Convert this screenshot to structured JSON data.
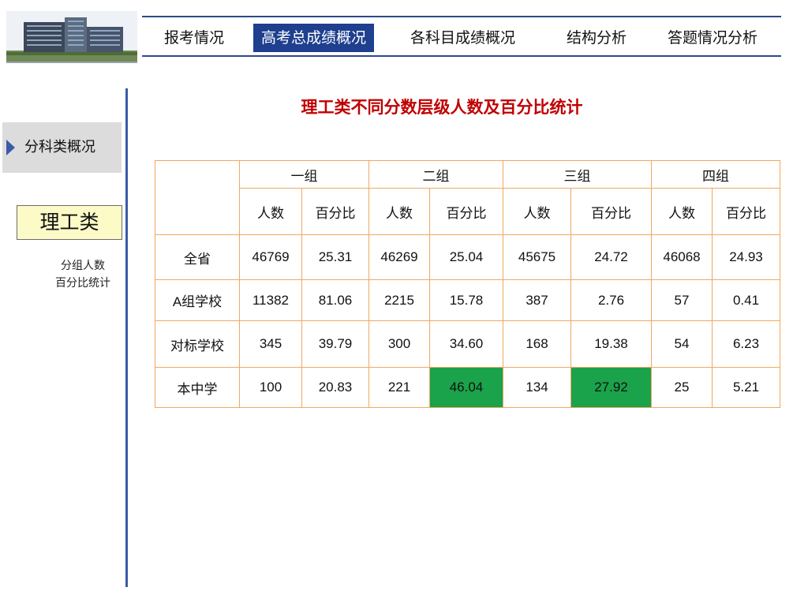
{
  "nav": {
    "items": [
      "报考情况",
      "高考总成绩概况",
      "各科目成绩概况",
      "结构分析",
      "答题情况分析"
    ],
    "active_index": 1
  },
  "sidebar": {
    "tab_label": "分科类概况",
    "category_label": "理工类",
    "note_lines": [
      "分组人数",
      "百分比统计"
    ]
  },
  "main": {
    "title": "理工类不同分数层级人数及百分比统计",
    "table": {
      "groups": [
        "一组",
        "二组",
        "三组",
        "四组"
      ],
      "subheaders": [
        "人数",
        "百分比",
        "人数",
        "百分比",
        "人数",
        "百分比",
        "人数",
        "百分比"
      ],
      "rows": [
        {
          "label": "全省",
          "cells": [
            "46769",
            "25.31",
            "46269",
            "25.04",
            "45675",
            "24.72",
            "46068",
            "24.93"
          ]
        },
        {
          "label": "A组学校",
          "cells": [
            "11382",
            "81.06",
            "2215",
            "15.78",
            "387",
            "2.76",
            "57",
            "0.41"
          ]
        },
        {
          "label": "对标学校",
          "cells": [
            "345",
            "39.79",
            "300",
            "34.60",
            "168",
            "19.38",
            "54",
            "6.23"
          ]
        },
        {
          "label": "本中学",
          "cells": [
            "100",
            "20.83",
            "221",
            "46.04",
            "134",
            "27.92",
            "25",
            "5.21"
          ]
        }
      ],
      "highlighted_cells": [
        [
          3,
          3
        ],
        [
          3,
          5
        ]
      ],
      "highlight_color": "#1aa34a",
      "border_color": "#f0a860"
    }
  },
  "colors": {
    "title": "#c00000",
    "nav_active_bg": "#1f3f8f",
    "accent_line": "#3a5ba8",
    "category_bg": "#fcfbc8",
    "side_tab_bg": "#dcdcdc"
  }
}
